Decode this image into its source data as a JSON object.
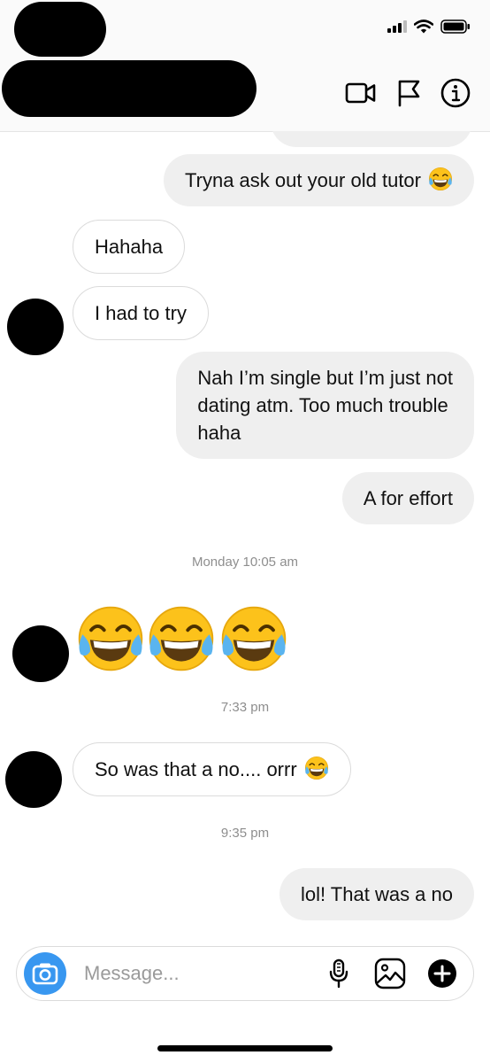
{
  "status_bar": {
    "icons": [
      "signal-icon",
      "wifi-icon",
      "battery-icon"
    ]
  },
  "header": {
    "actions": [
      "video-call-icon",
      "flag-icon",
      "info-icon"
    ]
  },
  "messages": [
    {
      "direction": "outgoing",
      "text": "Tryna ask out your old tutor",
      "emoji": "face-with-tears-of-joy"
    },
    {
      "direction": "incoming",
      "text": "Hahaha"
    },
    {
      "direction": "incoming",
      "text": "I had to try"
    },
    {
      "direction": "outgoing",
      "lines": [
        "Nah I’m single but I’m just not",
        "dating atm. Too much trouble",
        "haha"
      ]
    },
    {
      "direction": "outgoing",
      "text": "A for effort"
    },
    {
      "direction": "incoming",
      "text": "So was that a no.... orrr",
      "emoji": "face-with-tears-of-joy"
    },
    {
      "direction": "outgoing",
      "text": "lol! That was a no"
    }
  ],
  "timestamps": [
    "Monday 10:05 am",
    "7:33 pm",
    "9:35 pm"
  ],
  "big_emoji": {
    "name": "face-with-tears-of-joy",
    "count": 3
  },
  "composer": {
    "placeholder": "Message...",
    "icons": [
      "camera-icon",
      "microphone-icon",
      "gallery-icon",
      "add-icon"
    ]
  },
  "colors": {
    "outgoing_bubble": "#efefef",
    "incoming_border": "#dbdbdb",
    "camera_button": "#3897f0",
    "timestamp": "#8e8e8e"
  }
}
